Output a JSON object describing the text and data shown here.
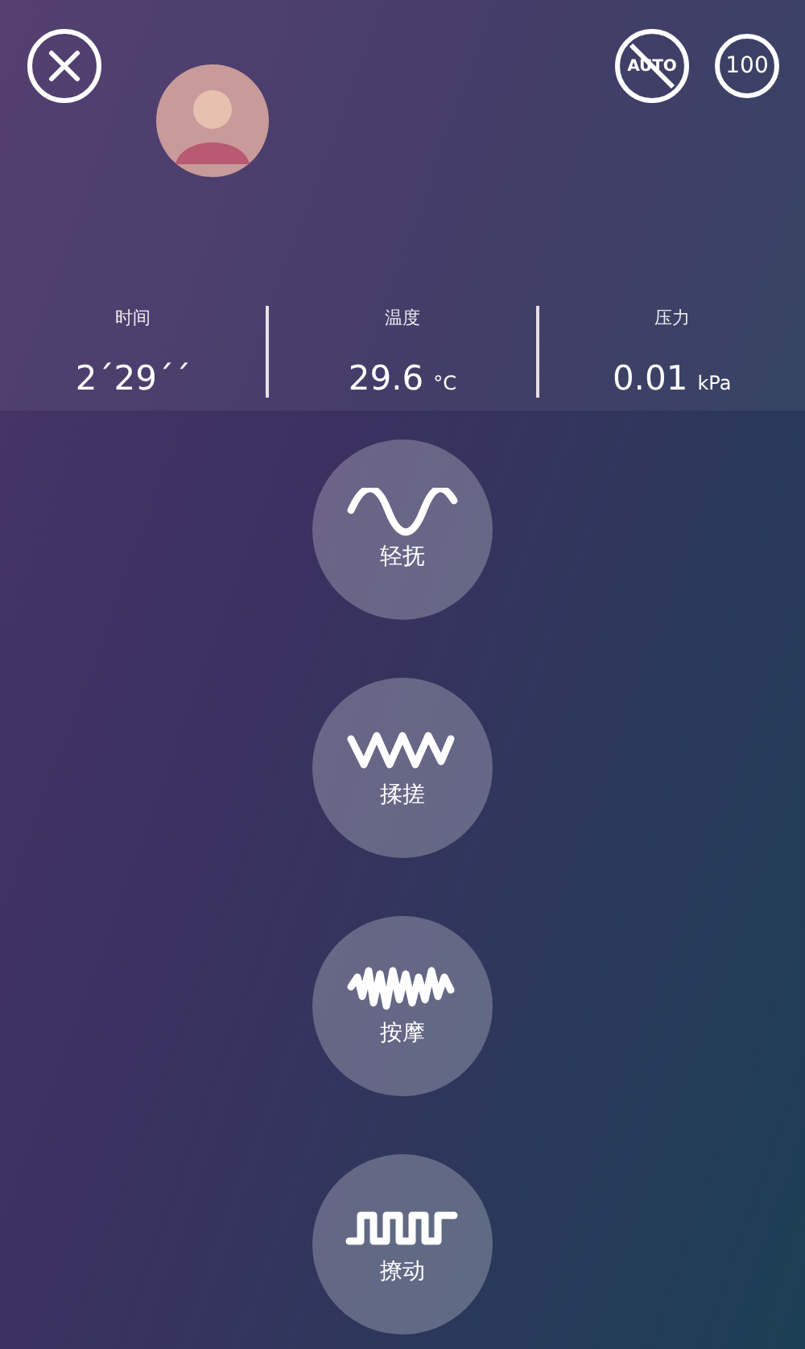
{
  "header": {
    "auto_button": {
      "label": "AUTO",
      "disabled": true
    },
    "intensity_button": {
      "label": "100"
    }
  },
  "stats": [
    {
      "label": "时间",
      "value": "2´29´´"
    },
    {
      "label": "温度",
      "value": "29.6",
      "unit": "°C"
    },
    {
      "label": "压力",
      "value": "0.01",
      "unit": "kPa"
    }
  ],
  "modes": [
    {
      "kind": "sine",
      "label": "轻抚"
    },
    {
      "kind": "zigzag",
      "label": "揉搓"
    },
    {
      "kind": "noise",
      "label": "按摩"
    },
    {
      "kind": "square",
      "label": "撩动"
    }
  ]
}
